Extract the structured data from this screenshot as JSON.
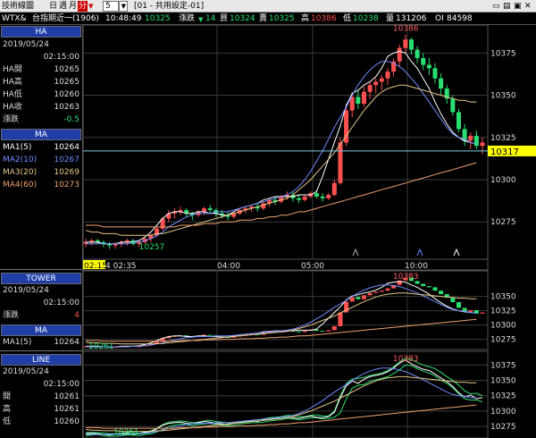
{
  "toolbar": {
    "title": "技術線圖",
    "period_tabs": [
      "日",
      "週",
      "月",
      "分"
    ],
    "active_period": "分",
    "interval_value": "5",
    "layout_select": "[01 - 共用設定-01]"
  },
  "quote": {
    "symbol": "WTX&",
    "name": "台指期近一(1906)",
    "time": "10:48:49",
    "price": "10325",
    "change_label": "漲跌",
    "change_icon": "down-triangle",
    "change_value": "14",
    "buy_label": "買",
    "buy_value": "10324",
    "sell_label": "賣",
    "sell_value": "10325",
    "high_label": "高",
    "high_value": "10386",
    "low_label": "低",
    "low_value": "10238",
    "volume_label": "量",
    "volume_value": "131206",
    "oi_label": "OI",
    "oi_value": "84598"
  },
  "left": {
    "ha": {
      "header": "HA",
      "date": "2019/05/24",
      "time": "02:15:00",
      "rows": [
        {
          "label": "HA開",
          "value": "10265"
        },
        {
          "label": "HA高",
          "value": "10265"
        },
        {
          "label": "HA低",
          "value": "10260"
        },
        {
          "label": "HA收",
          "value": "10263"
        },
        {
          "label": "漲跌",
          "value": "-0.5"
        }
      ]
    },
    "ma": {
      "header": "MA",
      "rows": [
        {
          "label": "MA1(5)",
          "value": "10264",
          "color": "#ffffff"
        },
        {
          "label": "MA2(10)",
          "value": "10267",
          "color": "#6f8cff"
        },
        {
          "label": "MA3(20)",
          "value": "10269",
          "color": "#e6c88a"
        },
        {
          "label": "MA4(60)",
          "value": "10273",
          "color": "#f0a070"
        }
      ]
    },
    "tower": {
      "header": "TOWER",
      "date": "2019/05/24",
      "time": "02:15:00",
      "row": {
        "label": "漲跌",
        "value": "4"
      }
    },
    "ma2": {
      "header": "MA",
      "row": {
        "label": "MA1(5)",
        "value": "10264"
      }
    },
    "line": {
      "header": "LINE",
      "date": "2019/05/24",
      "time": "02:15:00",
      "rows": [
        {
          "label": "開",
          "value": "10261"
        },
        {
          "label": "高",
          "value": "10261"
        },
        {
          "label": "低",
          "value": "10260"
        }
      ]
    }
  },
  "colors": {
    "up": "#ff5050",
    "down": "#28e070",
    "ma1": "#ffffff",
    "ma2": "#6f8cff",
    "ma3": "#e6c88a",
    "ma4": "#f0a070",
    "price_tag": "#ffff00",
    "grid": "#3a3a3a"
  },
  "chart_data": [
    {
      "type": "candlestick",
      "name": "HA",
      "ylim": [
        10255,
        10390
      ],
      "y_ticks": [
        10275,
        10300,
        10325,
        10350,
        10375
      ],
      "current_price": 10317,
      "high_label": "10386",
      "low_label": "10257",
      "x_ticks": [
        "02:15",
        "4 02:35",
        "04:00",
        "05:00",
        "10:00"
      ],
      "candles": [
        [
          10262,
          10265,
          10260,
          10263
        ],
        [
          10263,
          10265,
          10261,
          10264
        ],
        [
          10264,
          10265,
          10262,
          10263
        ],
        [
          10263,
          10264,
          10260,
          10262
        ],
        [
          10262,
          10263,
          10259,
          10261
        ],
        [
          10261,
          10263,
          10259,
          10262
        ],
        [
          10262,
          10264,
          10260,
          10263
        ],
        [
          10263,
          10265,
          10261,
          10264
        ],
        [
          10264,
          10265,
          10261,
          10262
        ],
        [
          10262,
          10264,
          10260,
          10263
        ],
        [
          10263,
          10266,
          10262,
          10265
        ],
        [
          10265,
          10268,
          10263,
          10267
        ],
        [
          10267,
          10272,
          10266,
          10271
        ],
        [
          10271,
          10278,
          10270,
          10277
        ],
        [
          10277,
          10282,
          10275,
          10280
        ],
        [
          10280,
          10283,
          10277,
          10281
        ],
        [
          10281,
          10284,
          10279,
          10282
        ],
        [
          10282,
          10283,
          10278,
          10280
        ],
        [
          10280,
          10281,
          10276,
          10279
        ],
        [
          10279,
          10282,
          10278,
          10281
        ],
        [
          10281,
          10284,
          10279,
          10283
        ],
        [
          10283,
          10285,
          10280,
          10282
        ],
        [
          10282,
          10283,
          10278,
          10280
        ],
        [
          10280,
          10282,
          10277,
          10279
        ],
        [
          10279,
          10281,
          10276,
          10278
        ],
        [
          10278,
          10281,
          10277,
          10280
        ],
        [
          10280,
          10283,
          10279,
          10282
        ],
        [
          10282,
          10284,
          10280,
          10283
        ],
        [
          10283,
          10285,
          10281,
          10284
        ],
        [
          10284,
          10286,
          10281,
          10283
        ],
        [
          10283,
          10287,
          10282,
          10286
        ],
        [
          10286,
          10289,
          10284,
          10288
        ],
        [
          10288,
          10290,
          10285,
          10287
        ],
        [
          10287,
          10291,
          10286,
          10290
        ],
        [
          10290,
          10293,
          10288,
          10291
        ],
        [
          10291,
          10293,
          10287,
          10289
        ],
        [
          10289,
          10291,
          10286,
          10288
        ],
        [
          10288,
          10291,
          10287,
          10290
        ],
        [
          10290,
          10293,
          10289,
          10292
        ],
        [
          10292,
          10294,
          10289,
          10290
        ],
        [
          10290,
          10292,
          10287,
          10289
        ],
        [
          10289,
          10292,
          10288,
          10291
        ],
        [
          10291,
          10300,
          10290,
          10298
        ],
        [
          10298,
          10325,
          10297,
          10322
        ],
        [
          10322,
          10345,
          10320,
          10341
        ],
        [
          10341,
          10352,
          10337,
          10349
        ],
        [
          10349,
          10353,
          10342,
          10345
        ],
        [
          10345,
          10355,
          10343,
          10352
        ],
        [
          10352,
          10358,
          10348,
          10356
        ],
        [
          10356,
          10360,
          10351,
          10358
        ],
        [
          10358,
          10362,
          10353,
          10360
        ],
        [
          10360,
          10366,
          10356,
          10364
        ],
        [
          10364,
          10372,
          10361,
          10370
        ],
        [
          10370,
          10380,
          10367,
          10378
        ],
        [
          10378,
          10386,
          10375,
          10383
        ],
        [
          10383,
          10384,
          10374,
          10377
        ],
        [
          10377,
          10379,
          10369,
          10372
        ],
        [
          10372,
          10375,
          10365,
          10368
        ],
        [
          10368,
          10372,
          10362,
          10366
        ],
        [
          10366,
          10369,
          10357,
          10360
        ],
        [
          10360,
          10363,
          10350,
          10354
        ],
        [
          10354,
          10356,
          10345,
          10348
        ],
        [
          10348,
          10350,
          10338,
          10340
        ],
        [
          10340,
          10342,
          10328,
          10330
        ],
        [
          10330,
          10333,
          10320,
          10323
        ],
        [
          10323,
          10328,
          10318,
          10326
        ],
        [
          10326,
          10329,
          10318,
          10320
        ],
        [
          10320,
          10325,
          10315,
          10322
        ]
      ],
      "ma1": [
        10263,
        10263,
        10263,
        10262,
        10262,
        10262,
        10263,
        10263,
        10263,
        10264,
        10266,
        10269,
        10273,
        10277,
        10280,
        10281,
        10281,
        10280,
        10280,
        10281,
        10281,
        10280,
        10280,
        10279,
        10279,
        10281,
        10283,
        10284,
        10285,
        10286,
        10288,
        10289,
        10290,
        10290,
        10290,
        10290,
        10291,
        10291,
        10291,
        10293,
        10302,
        10312,
        10322,
        10332,
        10344,
        10351,
        10353,
        10356,
        10358,
        10361,
        10366,
        10373,
        10375,
        10376,
        10375,
        10370,
        10366,
        10360,
        10354,
        10346,
        10339,
        10333,
        10328,
        10325,
        10323,
        10322,
        10321
      ],
      "ma2": [
        10262,
        10262,
        10262,
        10262,
        10262,
        10262,
        10262,
        10262,
        10263,
        10263,
        10264,
        10265,
        10267,
        10269,
        10272,
        10274,
        10276,
        10278,
        10279,
        10280,
        10280,
        10280,
        10281,
        10281,
        10281,
        10282,
        10283,
        10284,
        10285,
        10286,
        10287,
        10288,
        10289,
        10290,
        10291,
        10293,
        10296,
        10300,
        10305,
        10311,
        10317,
        10324,
        10331,
        10337,
        10343,
        10350,
        10356,
        10361,
        10365,
        10368,
        10370,
        10370,
        10369,
        10367,
        10364,
        10360,
        10356,
        10351,
        10346,
        10341,
        10336,
        10331,
        10327,
        10325,
        10324,
        10322,
        10321
      ],
      "ma3": [
        10270,
        10269,
        10269,
        10268,
        10268,
        10268,
        10267,
        10267,
        10267,
        10267,
        10267,
        10267,
        10268,
        10268,
        10269,
        10270,
        10271,
        10272,
        10273,
        10274,
        10275,
        10276,
        10277,
        10278,
        10279,
        10280,
        10281,
        10282,
        10283,
        10284,
        10285,
        10286,
        10287,
        10288,
        10289,
        10291,
        10294,
        10297,
        10300,
        10304,
        10308,
        10312,
        10316,
        10321,
        10326,
        10331,
        10336,
        10341,
        10345,
        10349,
        10352,
        10354,
        10355,
        10356,
        10356,
        10355,
        10354,
        10353,
        10352,
        10351,
        10350,
        10349,
        10348,
        10347,
        10347,
        10346,
        10346
      ],
      "ma4": [
        10273,
        10273,
        10273,
        10272,
        10272,
        10272,
        10272,
        10272,
        10272,
        10272,
        10272,
        10272,
        10272,
        10272,
        10272,
        10272,
        10273,
        10273,
        10273,
        10273,
        10274,
        10274,
        10274,
        10275,
        10275,
        10275,
        10276,
        10276,
        10276,
        10277,
        10277,
        10278,
        10278,
        10279,
        10279,
        10280,
        10281,
        10281,
        10282,
        10283,
        10284,
        10285,
        10286,
        10287,
        10288,
        10289,
        10290,
        10291,
        10292,
        10293,
        10294,
        10295,
        10296,
        10297,
        10298,
        10299,
        10300,
        10301,
        10302,
        10303,
        10304,
        10305,
        10306,
        10307,
        10308,
        10309,
        10310
      ]
    },
    {
      "type": "tower",
      "name": "TOWER",
      "ylim": [
        10262,
        10390
      ],
      "y_ticks": [
        10275,
        10300,
        10325,
        10350
      ],
      "labels": {
        "high": "10383",
        "low": "10261"
      }
    },
    {
      "type": "line",
      "name": "LINE",
      "ylim": [
        10262,
        10390
      ],
      "y_ticks": [
        10275,
        10300,
        10325,
        10350,
        10375
      ],
      "labels": {
        "high": "10383",
        "low": "10261"
      }
    }
  ]
}
